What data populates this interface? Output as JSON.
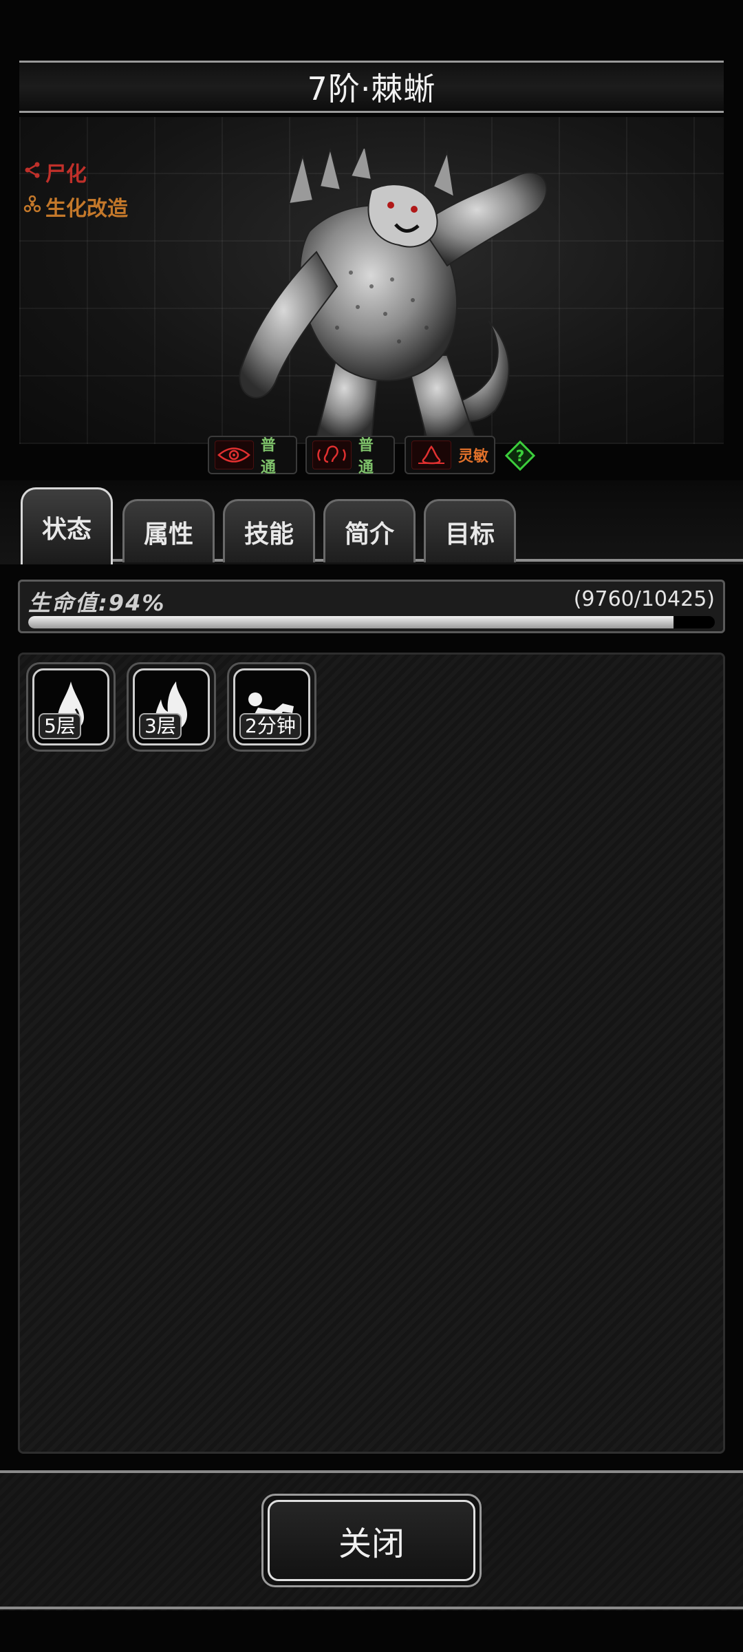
{
  "header": {
    "title": "7阶·棘蜥"
  },
  "monster": {
    "tags": [
      {
        "label": "尸化",
        "icon": "share-icon",
        "color": "#c0302a"
      },
      {
        "label": "生化改造",
        "icon": "biohazard-icon",
        "color": "#c4782a"
      }
    ],
    "senses": [
      {
        "icon": "eye-icon",
        "label": "普通",
        "color": "#7fc26b"
      },
      {
        "icon": "ear-icon",
        "label": "普通",
        "color": "#7fc26b"
      },
      {
        "icon": "smell-icon",
        "label": "灵敏",
        "color": "#e0702a"
      }
    ],
    "help_icon": "question-icon"
  },
  "tabs": [
    {
      "label": "状态",
      "active": true
    },
    {
      "label": "属性",
      "active": false
    },
    {
      "label": "技能",
      "active": false
    },
    {
      "label": "简介",
      "active": false
    },
    {
      "label": "目标",
      "active": false
    }
  ],
  "hp": {
    "label": "生命值:94%",
    "value_text": "(9760/10425)",
    "fraction": 0.94
  },
  "status_effects": [
    {
      "icon": "droplet-icon",
      "badge": "5层"
    },
    {
      "icon": "fire-icon",
      "badge": "3层"
    },
    {
      "icon": "sleep-icon",
      "badge": "2分钟"
    }
  ],
  "footer": {
    "close_label": "关闭"
  }
}
